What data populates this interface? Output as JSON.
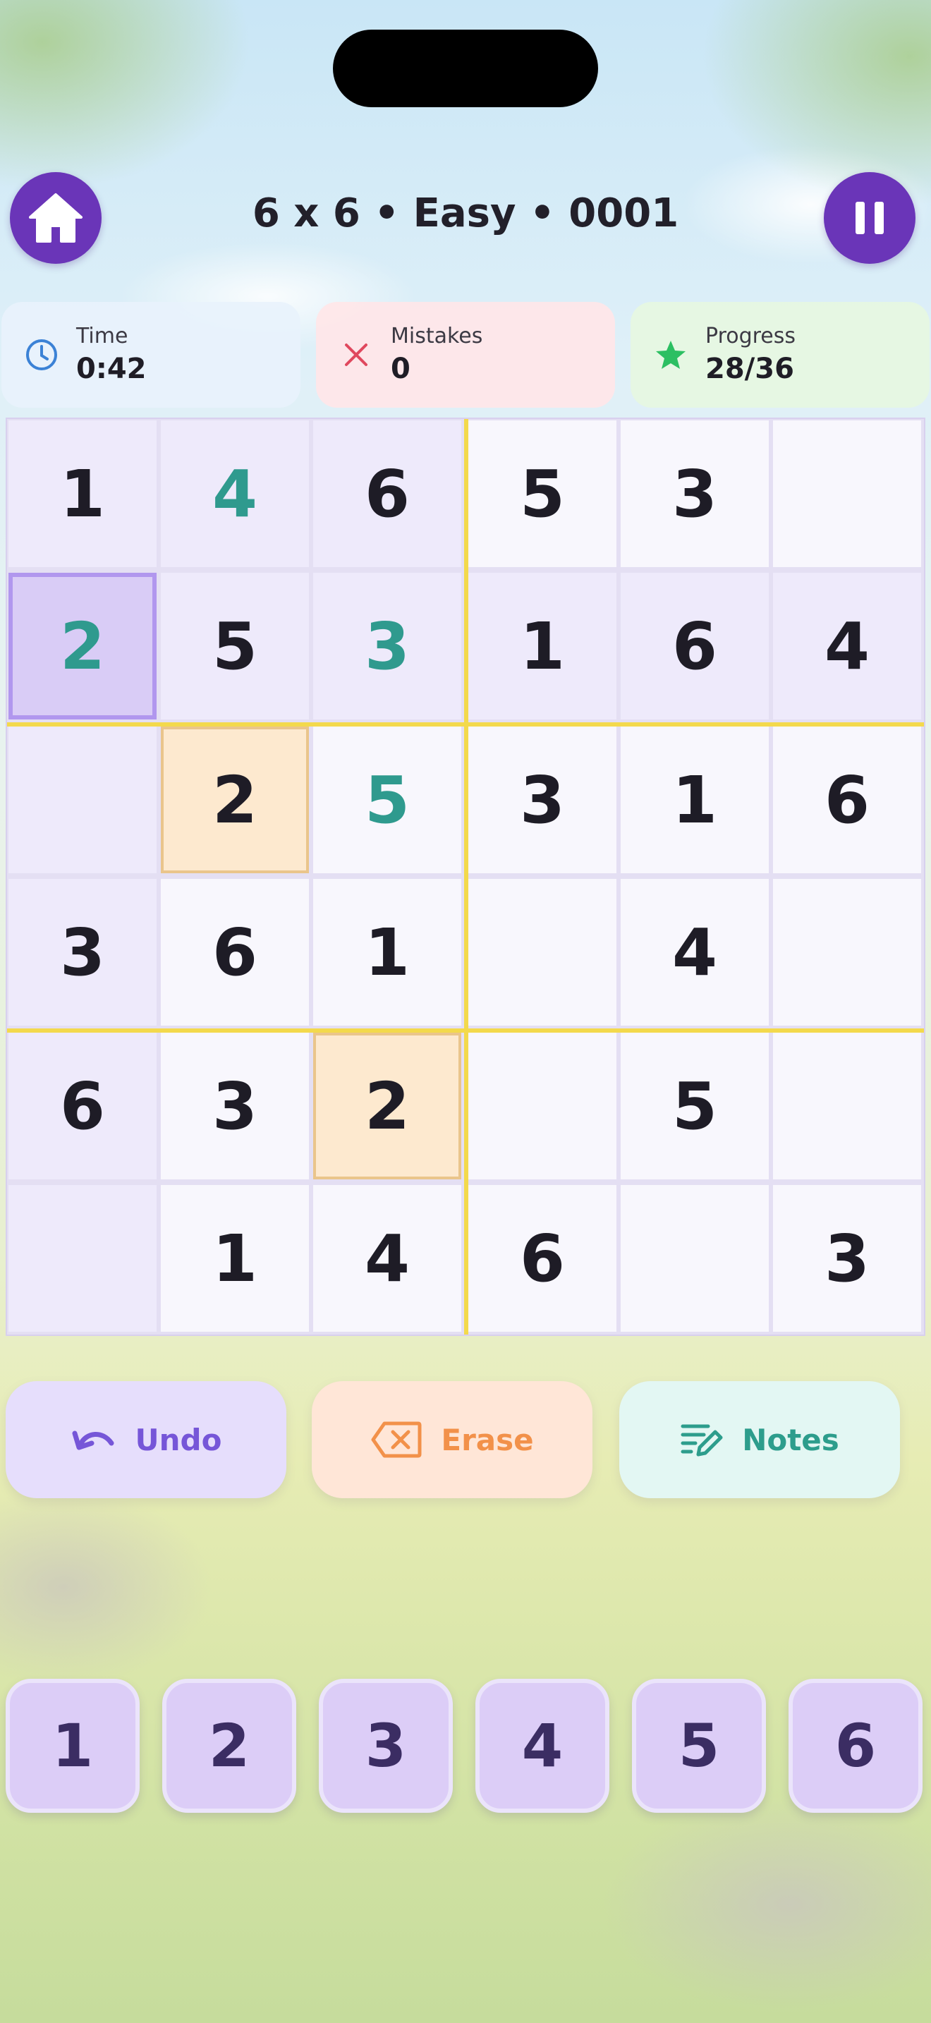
{
  "header": {
    "title": "6 x 6 • Easy • 0001",
    "home_icon": "home-icon",
    "pause_icon": "pause-icon"
  },
  "stats": {
    "time": {
      "label": "Time",
      "value": "0:42",
      "icon": "clock-icon",
      "color": "#3b82d6"
    },
    "mistakes": {
      "label": "Mistakes",
      "value": "0",
      "icon": "x-icon",
      "color": "#e0485e"
    },
    "progress": {
      "label": "Progress",
      "value": "28/36",
      "icon": "star-icon",
      "color": "#2cbf62"
    }
  },
  "board": {
    "size": 6,
    "box_rows": 2,
    "box_cols": 3,
    "cells": [
      [
        {
          "v": "1",
          "k": "given"
        },
        {
          "v": "4",
          "k": "user"
        },
        {
          "v": "6",
          "k": "given"
        },
        {
          "v": "5",
          "k": "given"
        },
        {
          "v": "3",
          "k": "given"
        },
        {
          "v": "",
          "k": "empty"
        }
      ],
      [
        {
          "v": "2",
          "k": "user",
          "selected": true
        },
        {
          "v": "5",
          "k": "given"
        },
        {
          "v": "3",
          "k": "user"
        },
        {
          "v": "1",
          "k": "given"
        },
        {
          "v": "6",
          "k": "given"
        },
        {
          "v": "4",
          "k": "given"
        }
      ],
      [
        {
          "v": "",
          "k": "empty"
        },
        {
          "v": "2",
          "k": "given",
          "same": true
        },
        {
          "v": "5",
          "k": "user"
        },
        {
          "v": "3",
          "k": "given"
        },
        {
          "v": "1",
          "k": "given"
        },
        {
          "v": "6",
          "k": "given"
        }
      ],
      [
        {
          "v": "3",
          "k": "given"
        },
        {
          "v": "6",
          "k": "given"
        },
        {
          "v": "1",
          "k": "given"
        },
        {
          "v": "",
          "k": "empty"
        },
        {
          "v": "4",
          "k": "given"
        },
        {
          "v": "",
          "k": "empty"
        }
      ],
      [
        {
          "v": "6",
          "k": "given"
        },
        {
          "v": "3",
          "k": "given"
        },
        {
          "v": "2",
          "k": "given",
          "same": true
        },
        {
          "v": "",
          "k": "empty"
        },
        {
          "v": "5",
          "k": "given"
        },
        {
          "v": "",
          "k": "empty"
        }
      ],
      [
        {
          "v": "",
          "k": "empty"
        },
        {
          "v": "1",
          "k": "given"
        },
        {
          "v": "4",
          "k": "given"
        },
        {
          "v": "6",
          "k": "given"
        },
        {
          "v": "",
          "k": "empty"
        },
        {
          "v": "3",
          "k": "given"
        }
      ]
    ],
    "colors": {
      "given_text": "#1e1c26",
      "user_text": "#2f9a8e",
      "selected_bg": "#d9ccf6",
      "selected_border": "#b197ee",
      "same_number_bg": "#fde9cf",
      "same_number_border": "#eac58b",
      "related_bg": "#eeeafb",
      "cell_bg": "#f8f7fd",
      "box_divider": "#f3d94c"
    }
  },
  "actions": {
    "undo": {
      "label": "Undo",
      "icon": "undo-icon"
    },
    "erase": {
      "label": "Erase",
      "icon": "erase-icon"
    },
    "notes": {
      "label": "Notes",
      "icon": "notes-pencil-icon"
    }
  },
  "numpad": [
    "1",
    "2",
    "3",
    "4",
    "5",
    "6"
  ]
}
